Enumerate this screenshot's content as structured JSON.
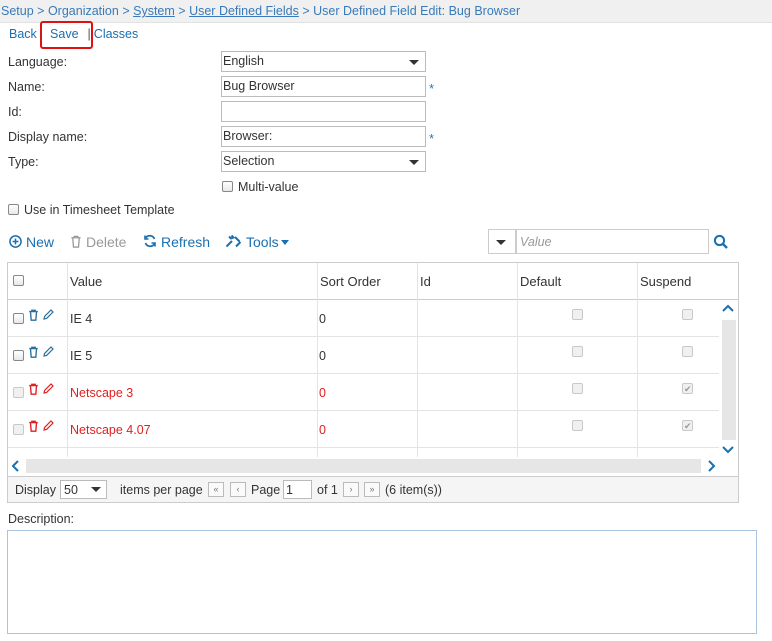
{
  "breadcrumb": {
    "setup": "Setup",
    "organization": "Organization",
    "system": "System",
    "user_defined_fields": "User Defined Fields",
    "current": "User Defined Field Edit: Bug Browser",
    "sep": ">"
  },
  "actions": {
    "back": "Back",
    "save": "Save",
    "classes": "Classes",
    "bar": "|"
  },
  "form": {
    "language_label": "Language:",
    "language_value": "English",
    "name_label": "Name:",
    "name_value": "Bug Browser",
    "id_label": "Id:",
    "id_value": "",
    "display_name_label": "Display name:",
    "display_name_value": "Browser:",
    "type_label": "Type:",
    "type_value": "Selection",
    "multi_value_label": "Multi-value",
    "timesheet_label": "Use in Timesheet Template",
    "required_mark": "*"
  },
  "toolbar": {
    "new": "New",
    "delete": "Delete",
    "refresh": "Refresh",
    "tools": "Tools",
    "filter_placeholder": "Value"
  },
  "grid": {
    "columns": {
      "value": "Value",
      "sort_order": "Sort Order",
      "id": "Id",
      "default": "Default",
      "suspend": "Suspend"
    },
    "rows": [
      {
        "value": "IE 4",
        "sort_order": "0",
        "id": "",
        "default": false,
        "suspend": false,
        "suspended_style": false
      },
      {
        "value": "IE 5",
        "sort_order": "0",
        "id": "",
        "default": false,
        "suspend": false,
        "suspended_style": false
      },
      {
        "value": "Netscape 3",
        "sort_order": "0",
        "id": "",
        "default": false,
        "suspend": true,
        "suspended_style": true
      },
      {
        "value": "Netscape 4.07",
        "sort_order": "0",
        "id": "",
        "default": false,
        "suspend": true,
        "suspended_style": true
      }
    ]
  },
  "pager": {
    "display_label": "Display",
    "page_size": "50",
    "items_per_page": "items per page",
    "page_label": "Page",
    "page_value": "1",
    "of_label": "of 1",
    "item_count": "(6 item(s))"
  },
  "description": {
    "label": "Description:",
    "value": ""
  },
  "colors": {
    "link": "#1a6fb0",
    "suspended_text": "#e02020",
    "highlight": "#e01010"
  }
}
